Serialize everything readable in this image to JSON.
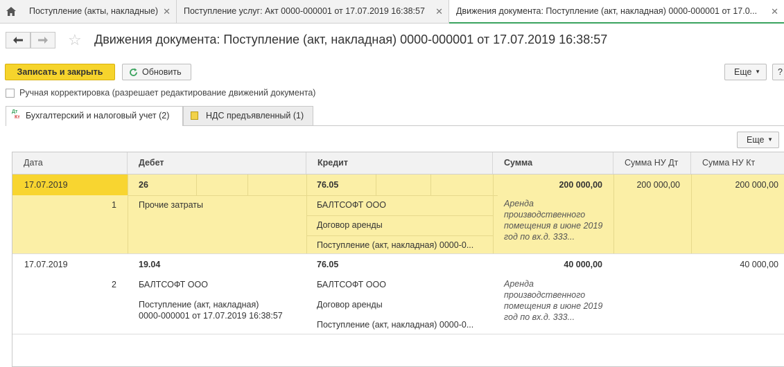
{
  "top_tabs": [
    {
      "label": "Поступление (акты, накладные)"
    },
    {
      "label": "Поступление услуг: Акт 0000-000001 от 17.07.2019 16:38:57"
    },
    {
      "label": "Движения документа: Поступление (акт, накладная) 0000-000001 от 17.0..."
    }
  ],
  "header": {
    "title": "Движения документа: Поступление (акт, накладная) 0000-000001 от 17.07.2019 16:38:57"
  },
  "toolbar": {
    "save_close": "Записать и закрыть",
    "refresh": "Обновить",
    "more": "Еще",
    "help": "?"
  },
  "manual_correction": {
    "checked": false,
    "label": "Ручная корректировка (разрешает редактирование движений документа)"
  },
  "sub_tabs": [
    {
      "icon_text": "Дт\nКт",
      "label": "Бухгалтерский и налоговый учет (2)"
    },
    {
      "label": "НДС предъявленный (1)"
    }
  ],
  "table": {
    "more": "Еще",
    "columns": [
      "Дата",
      "Дебет",
      "Кредит",
      "Сумма",
      "Сумма НУ Дт",
      "Сумма НУ Кт"
    ],
    "rows": [
      {
        "date": "17.07.2019",
        "num": "1",
        "debit_account": "26",
        "debit_sub": [
          "Прочие затраты"
        ],
        "credit_account": "76.05",
        "credit_sub": [
          "БАЛТСОФТ ООО",
          "Договор аренды",
          "Поступление (акт, накладная) 0000-0..."
        ],
        "sum": "200 000,00",
        "note": "Аренда производственного помещения в июне 2019 год по вх.д. 333...",
        "sum_nu_dt": "200 000,00",
        "sum_nu_kt": "200 000,00"
      },
      {
        "date": "17.07.2019",
        "num": "2",
        "debit_account": "19.04",
        "debit_sub": [
          "БАЛТСОФТ ООО",
          "Поступление (акт, накладная)",
          "0000-000001 от 17.07.2019 16:38:57"
        ],
        "credit_account": "76.05",
        "credit_sub": [
          "БАЛТСОФТ ООО",
          "Договор аренды",
          "Поступление (акт, накладная) 0000-0..."
        ],
        "sum": "40 000,00",
        "note": "Аренда производственного помещения в июне 2019 год по вх.д. 333...",
        "sum_nu_dt": "",
        "sum_nu_kt": "40 000,00"
      }
    ]
  }
}
